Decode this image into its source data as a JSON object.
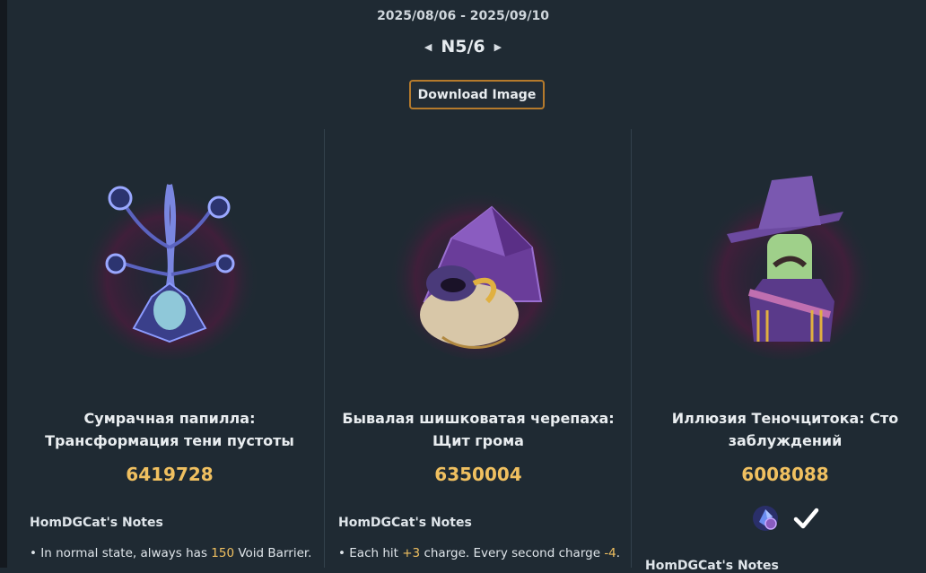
{
  "header": {
    "date_range": "2025/08/06 - 2025/09/10",
    "page_indicator": "N5/6",
    "download_label": "Download Image"
  },
  "cards": [
    {
      "title": "Сумрачная папилла: Трансформация тени пустоты",
      "score": "6419728",
      "notes_heading": "HomDGCat's Notes",
      "note": {
        "bullet": "•",
        "before": "In normal state, always has",
        "value": "150",
        "after": "Void Barrier."
      }
    },
    {
      "title": "Бывалая шишковатая черепаха: Щит грома",
      "score": "6350004",
      "notes_heading": "HomDGCat's Notes",
      "note": {
        "bullet": "•",
        "p1": "Each hit",
        "v1": "+3",
        "p2": "charge. Every second charge",
        "v2": "-4",
        "p3": "."
      }
    },
    {
      "title": "Иллюзия Теночцитока: Сто заблуждений",
      "score": "6008088",
      "notes_heading": "HomDGCat's Notes",
      "badges": [
        "gem-icon",
        "checkmark-icon"
      ]
    }
  ],
  "colors": {
    "accent_gold": "#f0c060",
    "button_border": "#b57a2c",
    "background": "#1f2a33"
  }
}
